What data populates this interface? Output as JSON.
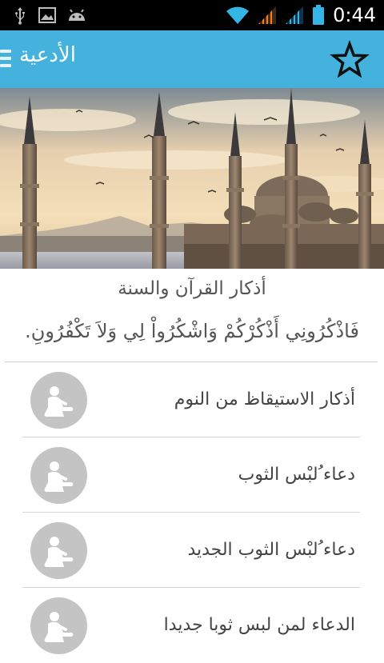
{
  "status_bar": {
    "time": "0:44",
    "icons": [
      "usb-icon",
      "image-icon",
      "android-icon",
      "wifi-icon",
      "signal-icon",
      "signal-icon",
      "battery-icon"
    ]
  },
  "action_bar": {
    "title": "الأدعية",
    "icons": [
      "drawer-menu-icon",
      "star-icon"
    ]
  },
  "colors": {
    "action_bar": "#45b2de",
    "status_bar": "#000000",
    "signal_orange": "#ff7a1a",
    "signal_blue": "#33b5e5",
    "avatar_grey": "#c4c4c4"
  },
  "header": {
    "title": "أذكار القرآن والسنة",
    "verse": "فَاذْكُرُونِي أَذْكُرْكُمْ وَاشْكُرُواْ لِي وَلاَ تَكْفُرُونِ."
  },
  "items": [
    {
      "label": "أذكار الاستيقاظ من النوم",
      "icon": "prayer-icon"
    },
    {
      "label": "دعاء ُلبْس الثوب",
      "icon": "prayer-icon"
    },
    {
      "label": "دعاء ُلبْس الثوب الجديد",
      "icon": "prayer-icon"
    },
    {
      "label": "الدعاء لمن لبس ثوبا جديدا",
      "icon": "prayer-icon"
    }
  ]
}
